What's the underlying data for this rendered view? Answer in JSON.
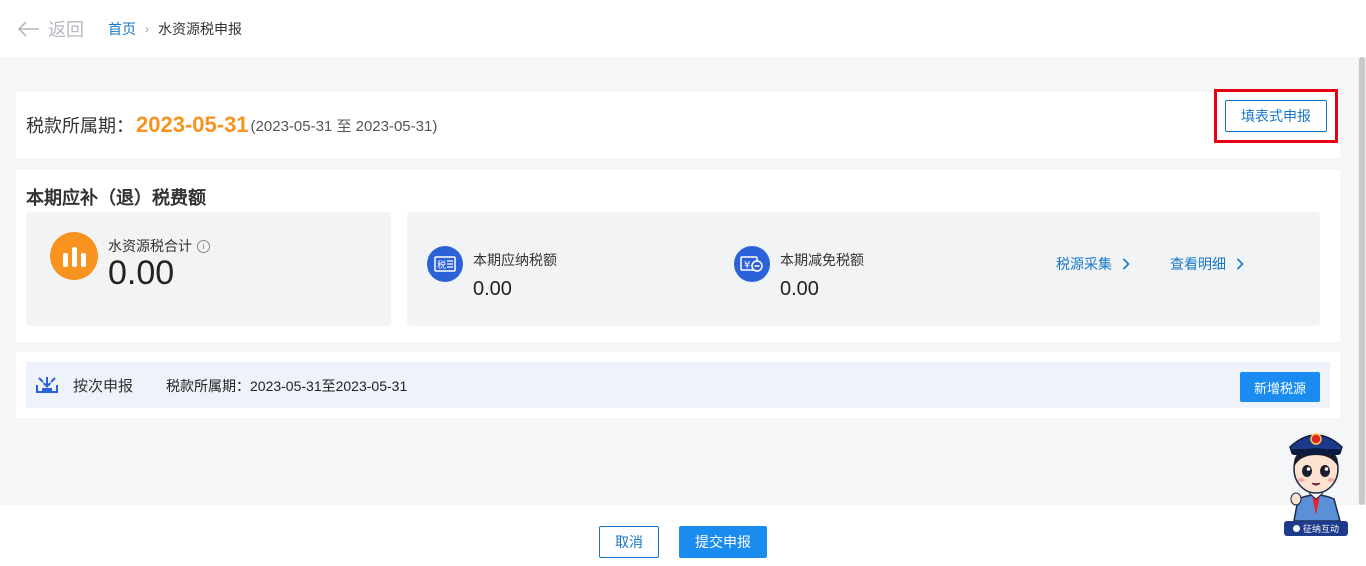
{
  "header": {
    "back_label": "返回",
    "breadcrumb": {
      "home": "首页",
      "separator": "›",
      "current": "水资源税申报"
    }
  },
  "period": {
    "label": "税款所属期：",
    "date": "2023-05-31",
    "range": "(2023-05-31 至 2023-05-31)",
    "fill_button": "填表式申报"
  },
  "amount": {
    "title": "本期应补（退）税费额",
    "total": {
      "label": "水资源税合计",
      "value": "0.00",
      "info_glyph": "i"
    },
    "metrics": [
      {
        "label": "本期应纳税额",
        "value": "0.00",
        "icon": "tax-document-icon",
        "icon_text": "税"
      },
      {
        "label": "本期减免税额",
        "value": "0.00",
        "icon": "yen-minus-icon",
        "icon_text": "¥"
      }
    ],
    "links": [
      {
        "label": "税源采集"
      },
      {
        "label": "查看明细"
      }
    ]
  },
  "declaration": {
    "title": "按次申报",
    "period": "税款所属期：2023-05-31至2023-05-31",
    "add_button": "新增税源"
  },
  "footer": {
    "cancel": "取消",
    "submit": "提交申报"
  },
  "assistant": {
    "badge": "征纳互动"
  },
  "colors": {
    "accent_orange": "#f7931e",
    "link_blue": "#1677c8",
    "primary_blue": "#1a8cf0",
    "highlight_red": "#e60012",
    "icon_blue": "#2b62d9"
  }
}
